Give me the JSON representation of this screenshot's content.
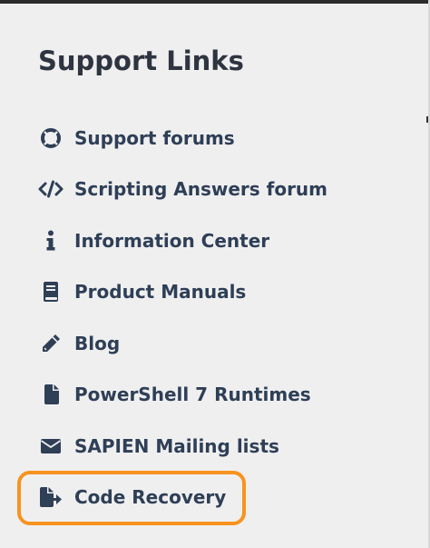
{
  "section": {
    "title": "Support Links"
  },
  "links": [
    {
      "label": "Support forums",
      "icon": "life-ring-icon"
    },
    {
      "label": "Scripting Answers forum",
      "icon": "code-icon"
    },
    {
      "label": "Information Center",
      "icon": "info-icon"
    },
    {
      "label": "Product Manuals",
      "icon": "book-icon"
    },
    {
      "label": "Blog",
      "icon": "pencil-icon"
    },
    {
      "label": "PowerShell 7 Runtimes",
      "icon": "file-icon"
    },
    {
      "label": "SAPIEN Mailing lists",
      "icon": "envelope-icon"
    },
    {
      "label": "Code Recovery",
      "icon": "file-export-icon"
    }
  ],
  "colors": {
    "text": "#2e3f56",
    "highlight": "#f7931e",
    "background": "#f0eff0"
  }
}
